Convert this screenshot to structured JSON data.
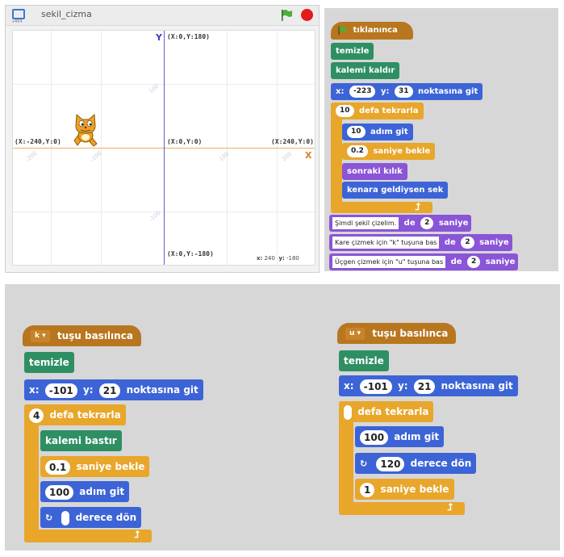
{
  "stage": {
    "title": "sekil_cizma",
    "version": "v454",
    "y_label": "Y",
    "x_label": "X",
    "coord_top": "(X:0,Y:180)",
    "coord_bottom": "(X:0,Y:-180)",
    "coord_left": "(X:-240,Y:0)",
    "coord_right": "(X:240,Y:0)",
    "coord_center": "(X:0,Y:0)",
    "mouse_x_label": "x:",
    "mouse_x": "240",
    "mouse_y_label": "y:",
    "mouse_y": "-180",
    "axis_marks": [
      "-200",
      "-100",
      "100",
      "200",
      "100",
      "-100"
    ]
  },
  "script_main": {
    "hat_label": "tıklanınca",
    "b1": "temizle",
    "b2": "kalemi kaldır",
    "b3": {
      "x_label": "x:",
      "x": "-223",
      "y_label": "y:",
      "y": "31",
      "tail": "noktasına git"
    },
    "b4": {
      "count": "10",
      "label": "defa tekrarla"
    },
    "b5": {
      "steps": "10",
      "label": "adım git"
    },
    "b6": {
      "secs": "0.2",
      "label": "saniye bekle"
    },
    "b7": "sonraki kılık",
    "b8": "kenara geldiysen sek",
    "b9": {
      "text": "Şimdi şekil çizelim.",
      "de": "de",
      "secs": "2",
      "unit": "saniye"
    },
    "b10": {
      "text": "Kare çizmek için \"k\" tuşuna bas",
      "de": "de",
      "secs": "2",
      "unit": "saniye"
    },
    "b11": {
      "text": "Üçgen çizmek için \"u\" tuşuna bas",
      "de": "de",
      "secs": "2",
      "unit": "saniye"
    }
  },
  "script_k": {
    "key": "k",
    "hat_label": "tuşu basılınca",
    "b1": "temizle",
    "b2": {
      "x_label": "x:",
      "x": "-101",
      "y_label": "y:",
      "y": "21",
      "tail": "noktasına git"
    },
    "b3": {
      "count": "4",
      "label": "defa tekrarla"
    },
    "b4": "kalemi bastır",
    "b5": {
      "secs": "0.1",
      "label": "saniye bekle"
    },
    "b6": {
      "steps": "100",
      "label": "adım git"
    },
    "b7": {
      "label": "derece dön"
    }
  },
  "script_u": {
    "key": "u",
    "hat_label": "tuşu basılınca",
    "b1": "temizle",
    "b2": {
      "x_label": "x:",
      "x": "-101",
      "y_label": "y:",
      "y": "21",
      "tail": "noktasına git"
    },
    "b3": {
      "label": "defa tekrarla"
    },
    "b4": {
      "steps": "100",
      "label": "adım git"
    },
    "b5": {
      "deg": "120",
      "label": "derece dön"
    },
    "b6": {
      "secs": "1",
      "label": "saniye bekle"
    }
  },
  "colors": {
    "motion": "#3c64d6",
    "looks": "#8a55d7",
    "control": "#e8a62a",
    "pen": "#2e8f63",
    "events": "#b8761e"
  }
}
